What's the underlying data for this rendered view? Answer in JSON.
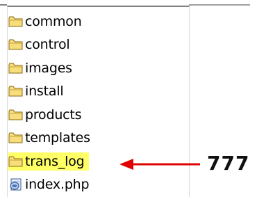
{
  "files": [
    {
      "name": "common",
      "type": "folder",
      "icon": "folder-icon"
    },
    {
      "name": "control",
      "type": "folder",
      "icon": "folder-icon"
    },
    {
      "name": "images",
      "type": "folder",
      "icon": "folder-icon"
    },
    {
      "name": "install",
      "type": "folder",
      "icon": "folder-icon"
    },
    {
      "name": "products",
      "type": "folder",
      "icon": "folder-icon"
    },
    {
      "name": "templates",
      "type": "folder",
      "icon": "folder-icon"
    },
    {
      "name": "trans_log",
      "type": "folder",
      "icon": "folder-icon",
      "highlighted": true
    },
    {
      "name": "index.php",
      "type": "php-file",
      "icon": "php-file-icon"
    }
  ],
  "annotation": {
    "text": "777"
  },
  "colors": {
    "highlight": "#ffff66",
    "arrow": "#e00000",
    "folder_fill": "#f7dd7c",
    "folder_outline": "#8a6a12"
  }
}
